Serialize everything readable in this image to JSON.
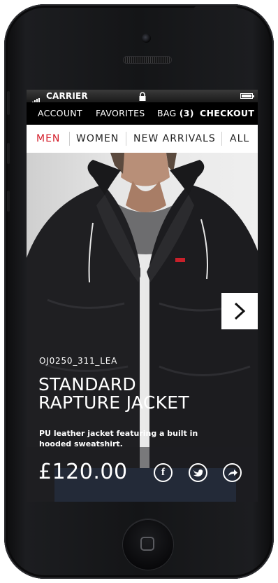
{
  "status_bar": {
    "carrier": "CARRIER"
  },
  "top_nav": {
    "account": "ACCOUNT",
    "favorites": "FAVORITES",
    "bag_label": "BAG",
    "bag_count": "(3)",
    "checkout": "CHECKOUT"
  },
  "category_nav": {
    "items": [
      {
        "label": "MEN",
        "active": true
      },
      {
        "label": "WOMEN",
        "active": false
      },
      {
        "label": "NEW ARRIVALS",
        "active": false
      },
      {
        "label": "ALL",
        "active": false
      }
    ]
  },
  "product": {
    "sku": "OJ0250_311_LEA",
    "title_line1": "STANDARD",
    "title_line2": "RAPTURE JACKET",
    "description": "PU leather jacket featuring a built in hooded sweatshirt.",
    "price": "£120.00"
  },
  "icons": {
    "next": "chevron-right-icon",
    "facebook": "facebook-icon",
    "twitter": "twitter-icon",
    "share": "share-icon"
  },
  "colors": {
    "accent": "#d4202c",
    "nav_bg": "#000000",
    "category_bg": "#ffffff"
  }
}
